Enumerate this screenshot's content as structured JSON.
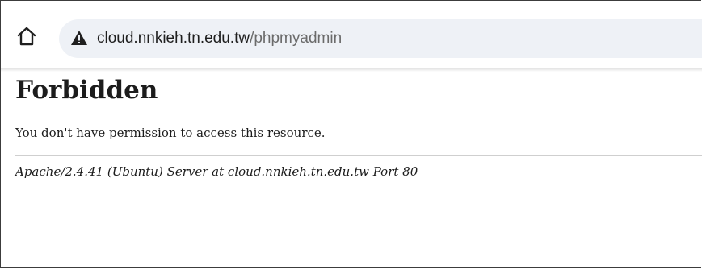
{
  "browser": {
    "url_host": "cloud.nnkieh.tn.edu.tw",
    "url_path": "/phpmyadmin",
    "home_icon": "home-icon",
    "security_icon": "warning-triangle-icon"
  },
  "page": {
    "heading": "Forbidden",
    "message": "You don't have permission to access this resource.",
    "server_signature": "Apache/2.4.41 (Ubuntu) Server at cloud.nnkieh.tn.edu.tw Port 80"
  }
}
